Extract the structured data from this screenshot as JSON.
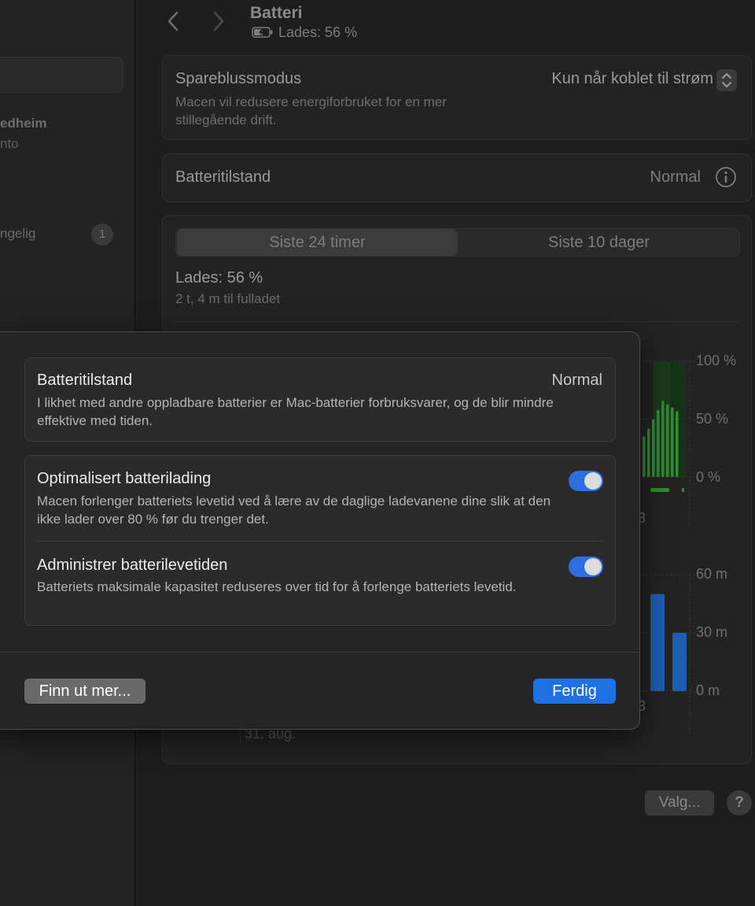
{
  "sidebar": {
    "account_line1": "edheim",
    "account_line2": "nto",
    "update_label": "ngelig",
    "update_count": "1"
  },
  "header": {
    "title": "Batteri",
    "status": "Lades: 56 %"
  },
  "low_power": {
    "title": "Spareblussmodus",
    "description": "Macen vil redusere energiforbruket for en mer stillegående drift.",
    "selected": "Kun når koblet til strøm"
  },
  "health": {
    "title": "Batteritilstand",
    "value": "Normal"
  },
  "usage": {
    "tabs": [
      "Siste 24 timer",
      "Siste 10 dager"
    ],
    "charge_title": "Lades: 56 %",
    "charge_sub": "2 t, 4 m til fulladet",
    "date": "31. aug.",
    "level_ticks": [
      "100 %",
      "50 %",
      "0 %"
    ],
    "time_ticks": [
      "60 m",
      "30 m",
      "0 m"
    ],
    "hour_label": "3"
  },
  "chart_data": [
    {
      "type": "bar",
      "title": "",
      "ylim": [
        0,
        100
      ],
      "yticks": [
        "100 %",
        "50 %",
        "0 %"
      ],
      "values": [
        35,
        42,
        50,
        58,
        66,
        63,
        60,
        57
      ]
    },
    {
      "type": "bar",
      "title": "",
      "ylim": [
        0,
        60
      ],
      "yticks": [
        "60 m",
        "30 m",
        "0 m"
      ],
      "values": [
        50,
        30
      ]
    }
  ],
  "colors": {
    "accent": "#1f6fe5",
    "toggle_on": "#2f6ee0",
    "level_bar": "#2f8f2f",
    "usage_bar": "#1d5fb3"
  },
  "footer": {
    "options_label": "Valg...",
    "help_label": "?"
  },
  "sheet": {
    "health_title": "Batteritilstand",
    "health_value": "Normal",
    "health_desc": "I likhet med andre oppladbare batterier er Mac-batterier forbruksvarer, og de blir mindre effektive med tiden.",
    "opt_title": "Optimalisert batterilading",
    "opt_desc": "Macen forlenger batteriets levetid ved å lære av de daglige ladevanene dine slik at den ikke lader over 80 % før du trenger det.",
    "opt_on": true,
    "mgr_title": "Administrer batterilevetiden",
    "mgr_desc": "Batteriets maksimale kapasitet reduseres over tid for å forlenge batteriets levetid.",
    "mgr_on": true,
    "learn_more": "Finn ut mer...",
    "done": "Ferdig"
  }
}
